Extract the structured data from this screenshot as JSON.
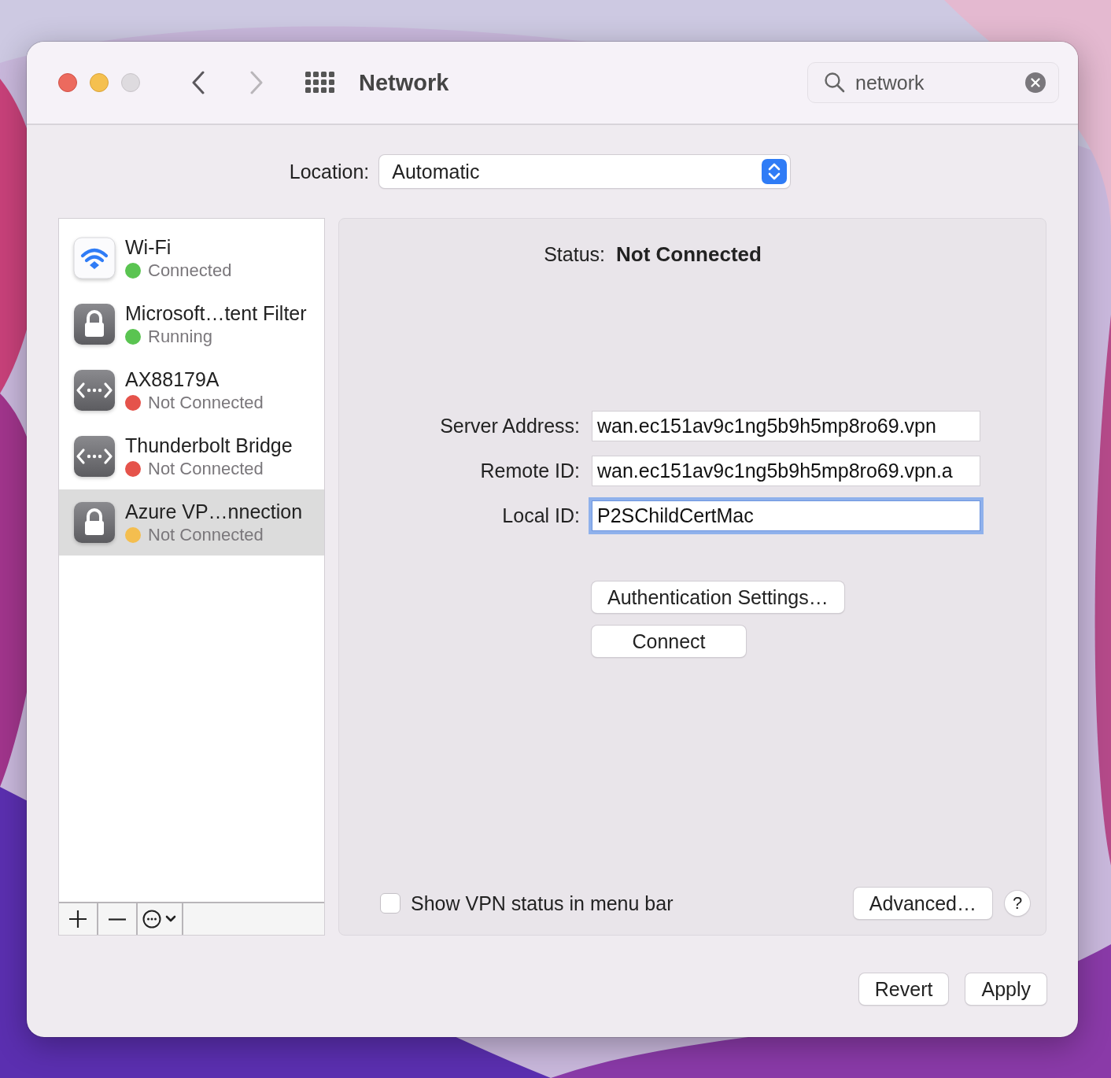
{
  "window": {
    "title": "Network",
    "back_enabled": true,
    "forward_enabled": false
  },
  "search": {
    "value": "network"
  },
  "location": {
    "label": "Location:",
    "value": "Automatic"
  },
  "services": [
    {
      "name": "Wi-Fi",
      "status": "Connected",
      "kind": "wifi",
      "color": "#5ac451",
      "selected": false
    },
    {
      "name": "Microsoft…tent Filter",
      "status": "Running",
      "kind": "lock",
      "color": "#5ac451",
      "selected": false
    },
    {
      "name": "AX88179A",
      "status": "Not Connected",
      "kind": "ethernet",
      "color": "#e5534b",
      "selected": false
    },
    {
      "name": "Thunderbolt Bridge",
      "status": "Not Connected",
      "kind": "ethernet",
      "color": "#e5534b",
      "selected": false
    },
    {
      "name": "Azure VP…nnection",
      "status": "Not Connected",
      "kind": "lock",
      "color": "#f4be4f",
      "selected": true
    }
  ],
  "detail": {
    "status_label": "Status:",
    "status_value": "Not Connected",
    "fields": [
      {
        "label": "Server Address:",
        "value": "wan.ec151av9c1ng5b9h5mp8ro69.vpn",
        "focused": false
      },
      {
        "label": "Remote ID:",
        "value": "wan.ec151av9c1ng5b9h5mp8ro69.vpn.a",
        "focused": false
      },
      {
        "label": "Local ID:",
        "value": "P2SChildCertMac",
        "focused": true
      }
    ],
    "buttons": [
      "Authentication Settings…",
      "Connect"
    ],
    "show_status": {
      "label": "Show VPN status in menu bar",
      "checked": false
    },
    "advanced": "Advanced…",
    "help": "?"
  },
  "footer_buttons": [
    "Revert",
    "Apply"
  ]
}
